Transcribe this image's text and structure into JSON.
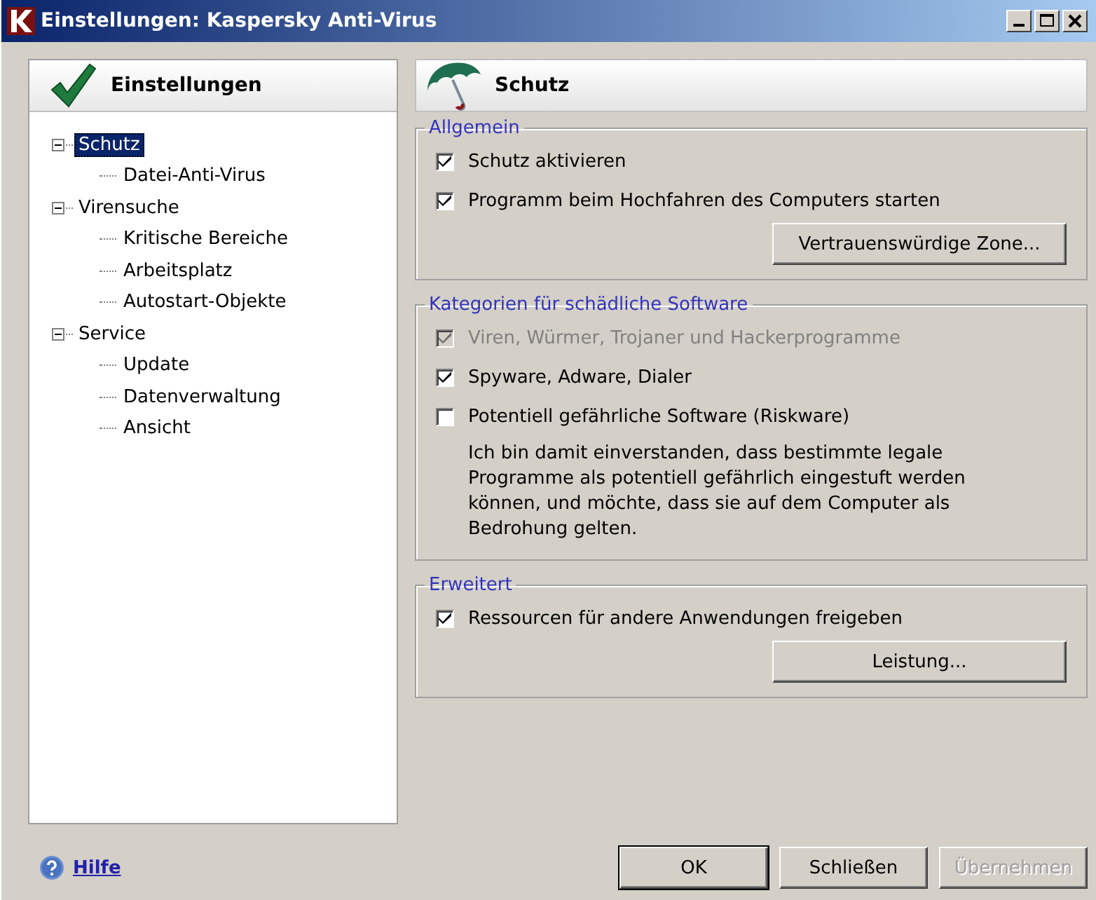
{
  "window": {
    "title": "Einstellungen: Kaspersky Anti-Virus"
  },
  "sidebar": {
    "title": "Einstellungen",
    "tree": [
      {
        "label": "Schutz",
        "selected": true,
        "expanded": true,
        "children": [
          {
            "label": "Datei-Anti-Virus",
            "selected": false
          }
        ]
      },
      {
        "label": "Virensuche",
        "selected": false,
        "expanded": true,
        "children": [
          {
            "label": "Kritische Bereiche",
            "selected": false
          },
          {
            "label": "Arbeitsplatz",
            "selected": false
          },
          {
            "label": "Autostart-Objekte",
            "selected": false
          }
        ]
      },
      {
        "label": "Service",
        "selected": false,
        "expanded": true,
        "children": [
          {
            "label": "Update",
            "selected": false
          },
          {
            "label": "Datenverwaltung",
            "selected": false
          },
          {
            "label": "Ansicht",
            "selected": false
          }
        ]
      }
    ]
  },
  "panel": {
    "title": "Schutz",
    "groups": [
      {
        "title": "Allgemein",
        "items": [
          {
            "kind": "checkbox",
            "label": "Schutz aktivieren",
            "checked": true,
            "disabled": false
          },
          {
            "kind": "checkbox",
            "label": "Programm beim Hochfahren des Computers starten",
            "checked": true,
            "disabled": false
          },
          {
            "kind": "button",
            "label": "Vertrauenswürdige Zone..."
          }
        ]
      },
      {
        "title": "Kategorien für schädliche Software",
        "items": [
          {
            "kind": "checkbox",
            "label": "Viren, Würmer, Trojaner und Hackerprogramme",
            "checked": true,
            "disabled": true
          },
          {
            "kind": "checkbox",
            "label": "Spyware, Adware, Dialer",
            "checked": true,
            "disabled": false
          },
          {
            "kind": "checkbox",
            "label": "Potentiell gefährliche Software (Riskware)",
            "checked": false,
            "disabled": false
          },
          {
            "kind": "note",
            "label": "Ich bin damit einverstanden, dass bestimmte legale Programme als potentiell gefährlich eingestuft werden können, und möchte, dass sie auf dem Computer als Bedrohung gelten."
          }
        ]
      },
      {
        "title": "Erweitert",
        "items": [
          {
            "kind": "checkbox",
            "label": "Ressourcen für andere Anwendungen freigeben",
            "checked": true,
            "disabled": false
          },
          {
            "kind": "button",
            "label": "Leistung..."
          }
        ]
      }
    ]
  },
  "help_link": "Hilfe",
  "buttons": [
    {
      "label": "OK",
      "disabled": false,
      "default": true
    },
    {
      "label": "Schließen",
      "disabled": false,
      "default": false
    },
    {
      "label": "Übernehmen",
      "disabled": true,
      "default": false
    }
  ]
}
